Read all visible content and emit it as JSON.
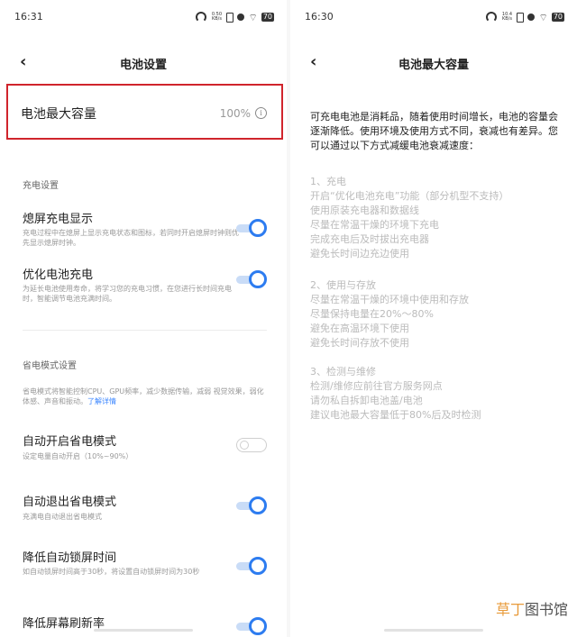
{
  "left": {
    "status": {
      "time": "16:31",
      "rate": "0.50 KB/s",
      "battery": "70"
    },
    "title": "电池设置",
    "capacity": {
      "label": "电池最大容量",
      "value": "100%",
      "info_glyph": "i"
    },
    "charging_section": "充电设置",
    "rows": [
      {
        "title": "熄屏充电显示",
        "desc": "充电过程中在熄屏上显示充电状态和图标，若同时开启熄屏时钟则优先显示熄屏时钟。",
        "on": true
      },
      {
        "title": "优化电池充电",
        "desc": "为延长电池使用寿命，将学习您的充电习惯，在您进行长时间充电时，智能调节电池充满时间。",
        "on": true
      }
    ],
    "power_section": "省电模式设置",
    "power_desc": "省电模式将智能控制CPU、GPU频率，减少数据传输，减弱 视觉效果，弱化体感、声音和振动。",
    "power_link": "了解详情",
    "rows2": [
      {
        "title": "自动开启省电模式",
        "desc": "设定电量自动开启（10%~90%）",
        "on": false
      },
      {
        "title": "自动退出省电模式",
        "desc": "充满电自动退出省电模式",
        "on": true
      },
      {
        "title": "降低自动锁屏时间",
        "desc": "如自动锁屏时间高于30秒，将设置自动锁屏时间为30秒",
        "on": true
      },
      {
        "title": "降低屏幕刷新率",
        "desc": "",
        "on": true
      }
    ]
  },
  "right": {
    "status": {
      "time": "16:30",
      "rate": "10.4 KB/s",
      "battery": "70"
    },
    "title": "电池最大容量",
    "intro": "可充电电池是消耗品，随着使用时间增长，电池的容量会逐渐降低。使用环境及使用方式不同，衰减也有差异。您可以通过以下方式减缓电池衰减速度：",
    "tips1": [
      "1、充电",
      "开启“优化电池充电”功能（部分机型不支持）",
      "使用原装充电器和数据线",
      "尽量在常温干燥的环境下充电",
      "完成充电后及时拔出充电器",
      "避免长时间边充边使用"
    ],
    "tips2": [
      "2、使用与存放",
      "尽量在常温干燥的环境中使用和存放",
      "尽量保持电量在20%～80%",
      "避免在高温环境下使用",
      "避免长时间存放不使用"
    ],
    "tips3": [
      "3、检测与维修",
      "检测/维修应前往官方服务网点",
      "请勿私自拆卸电池盖/电池",
      "建议电池最大容量低于80%后及时检测"
    ]
  },
  "watermark": {
    "a": "草丁",
    "b": "图书馆"
  },
  "colors": {
    "highlight_border": "#d0242c",
    "toggle_on": "#2d7cf0",
    "link": "#3b86ff"
  },
  "icons": {
    "back": "‹",
    "wifi": "⌔"
  }
}
